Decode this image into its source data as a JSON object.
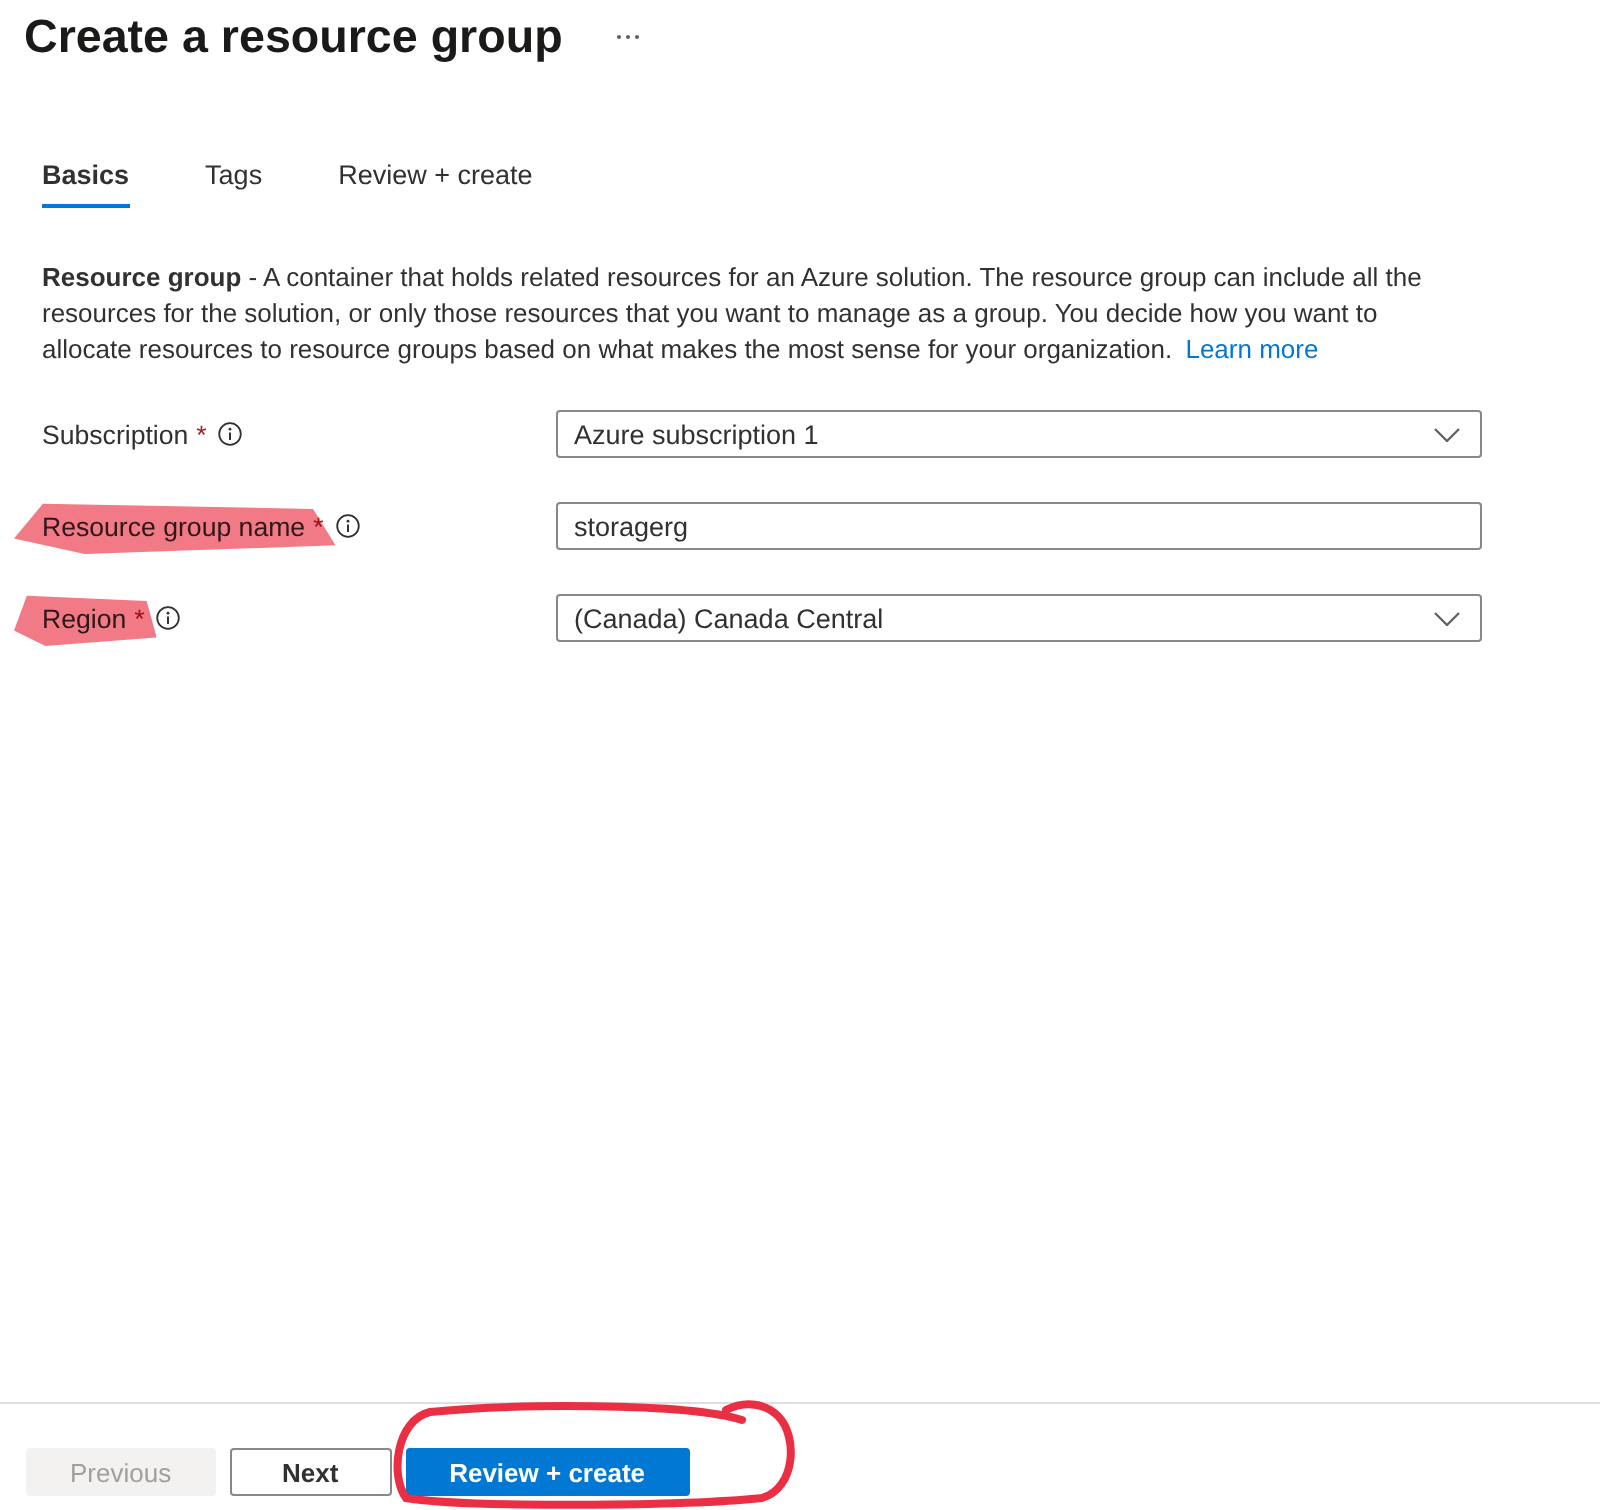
{
  "header": {
    "title": "Create a resource group"
  },
  "tabs": [
    {
      "label": "Basics",
      "selected": true
    },
    {
      "label": "Tags",
      "selected": false
    },
    {
      "label": "Review + create",
      "selected": false
    }
  ],
  "description": {
    "text": "**Resource group** - A container that holds related resources for an Azure solution. The resource group can include all the resources for the solution, or only those resources that you want to manage as a group. You decide how you want to allocate resources to resource groups based on what makes the most sense for your organization.",
    "link": "Learn more"
  },
  "fields": [
    {
      "kind": "dropdown",
      "label": "Subscription",
      "required_mark": "*",
      "value": "Azure subscription 1",
      "highlighted": false
    },
    {
      "kind": "text",
      "label": "Resource group name",
      "required_mark": "*",
      "value": "storagerg",
      "highlighted": true
    },
    {
      "kind": "dropdown",
      "label": "Region",
      "required_mark": "*",
      "value": "(Canada) Canada Central",
      "highlighted": true
    }
  ],
  "buttons": [
    {
      "label": "Previous",
      "kind": "secondary",
      "disabled": true,
      "circled": false
    },
    {
      "label": "Next",
      "kind": "secondary",
      "disabled": false,
      "circled": false
    },
    {
      "label": "Review + create",
      "kind": "primary",
      "disabled": false,
      "circled": true
    }
  ]
}
